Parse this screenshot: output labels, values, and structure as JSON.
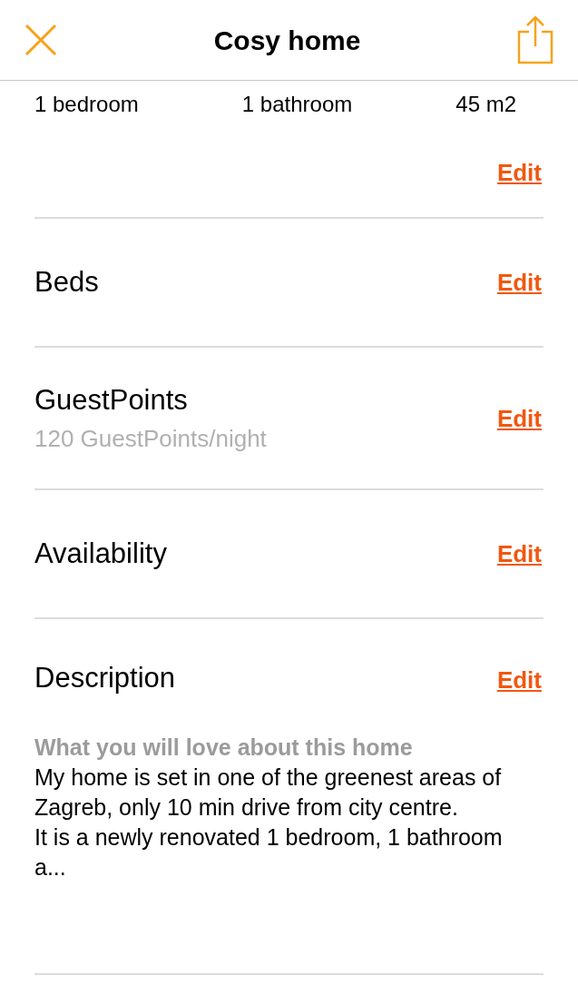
{
  "header": {
    "title": "Cosy home"
  },
  "stats": [
    "1 bedroom",
    "1 bathroom",
    "45 m2"
  ],
  "stats_edit": "Edit",
  "sections": [
    {
      "kind": "plain",
      "title": "Beds",
      "edit": "Edit"
    },
    {
      "kind": "subtitle",
      "title": "GuestPoints",
      "subtitle": "120 GuestPoints/night",
      "edit": "Edit"
    },
    {
      "kind": "plain",
      "title": "Availability",
      "edit": "Edit"
    },
    {
      "kind": "description",
      "title": "Description",
      "edit": "Edit",
      "heading": "What you will love about this home",
      "text": "My home is set in one of the greenest areas of Zagreb, only 10 min drive from city centre.\nIt is a newly renovated 1 bedroom, 1 bathroom a..."
    }
  ]
}
